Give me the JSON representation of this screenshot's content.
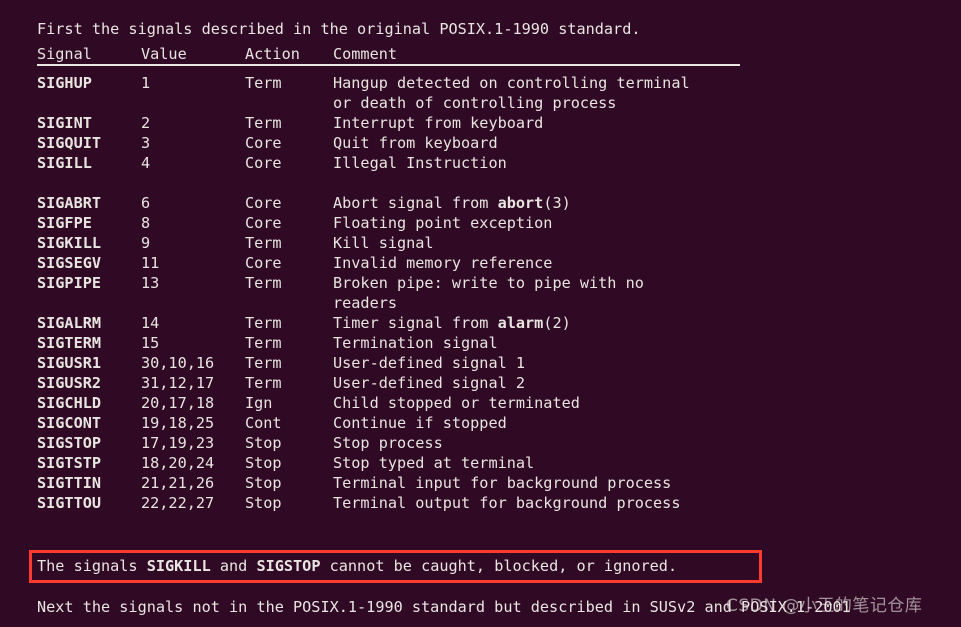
{
  "terminal": {
    "background_color": "#300a24",
    "text_color": "#e9e5e2",
    "highlight_color": "#ff3b30",
    "intro_line": "First the signals described in the original POSIX.1-1990 standard.",
    "columns": {
      "signal": "Signal",
      "value": "Value",
      "action": "Action",
      "comment": "Comment"
    },
    "rows": [
      {
        "signal": "SIGHUP",
        "value": "1",
        "action": "Term",
        "comment_pre": "Hangup detected on controlling terminal",
        "comment_bold": "",
        "comment_post": "",
        "cont": "or death of controlling process"
      },
      {
        "signal": "SIGINT",
        "value": "2",
        "action": "Term",
        "comment_pre": "Interrupt from keyboard",
        "comment_bold": "",
        "comment_post": "",
        "cont": ""
      },
      {
        "signal": "SIGQUIT",
        "value": "3",
        "action": "Core",
        "comment_pre": "Quit from keyboard",
        "comment_bold": "",
        "comment_post": "",
        "cont": ""
      },
      {
        "signal": "SIGILL",
        "value": "4",
        "action": "Core",
        "comment_pre": "Illegal Instruction",
        "comment_bold": "",
        "comment_post": "",
        "cont": ""
      },
      {
        "signal": "",
        "value": "",
        "action": "",
        "comment_pre": "",
        "comment_bold": "",
        "comment_post": "",
        "cont": ""
      },
      {
        "signal": "SIGABRT",
        "value": "6",
        "action": "Core",
        "comment_pre": "Abort signal from ",
        "comment_bold": "abort",
        "comment_post": "(3)",
        "cont": ""
      },
      {
        "signal": "SIGFPE",
        "value": "8",
        "action": "Core",
        "comment_pre": "Floating point exception",
        "comment_bold": "",
        "comment_post": "",
        "cont": ""
      },
      {
        "signal": "SIGKILL",
        "value": "9",
        "action": "Term",
        "comment_pre": "Kill signal",
        "comment_bold": "",
        "comment_post": "",
        "cont": ""
      },
      {
        "signal": "SIGSEGV",
        "value": "11",
        "action": "Core",
        "comment_pre": "Invalid memory reference",
        "comment_bold": "",
        "comment_post": "",
        "cont": ""
      },
      {
        "signal": "SIGPIPE",
        "value": "13",
        "action": "Term",
        "comment_pre": "Broken pipe: write to pipe with no",
        "comment_bold": "",
        "comment_post": "",
        "cont": "readers"
      },
      {
        "signal": "SIGALRM",
        "value": "14",
        "action": "Term",
        "comment_pre": "Timer signal from ",
        "comment_bold": "alarm",
        "comment_post": "(2)",
        "cont": ""
      },
      {
        "signal": "SIGTERM",
        "value": "15",
        "action": "Term",
        "comment_pre": "Termination signal",
        "comment_bold": "",
        "comment_post": "",
        "cont": ""
      },
      {
        "signal": "SIGUSR1",
        "value": "30,10,16",
        "action": "Term",
        "comment_pre": "User-defined signal 1",
        "comment_bold": "",
        "comment_post": "",
        "cont": ""
      },
      {
        "signal": "SIGUSR2",
        "value": "31,12,17",
        "action": "Term",
        "comment_pre": "User-defined signal 2",
        "comment_bold": "",
        "comment_post": "",
        "cont": ""
      },
      {
        "signal": "SIGCHLD",
        "value": "20,17,18",
        "action": "Ign",
        "comment_pre": "Child stopped or terminated",
        "comment_bold": "",
        "comment_post": "",
        "cont": ""
      },
      {
        "signal": "SIGCONT",
        "value": "19,18,25",
        "action": "Cont",
        "comment_pre": "Continue if stopped",
        "comment_bold": "",
        "comment_post": "",
        "cont": ""
      },
      {
        "signal": "SIGSTOP",
        "value": "17,19,23",
        "action": "Stop",
        "comment_pre": "Stop process",
        "comment_bold": "",
        "comment_post": "",
        "cont": ""
      },
      {
        "signal": "SIGTSTP",
        "value": "18,20,24",
        "action": "Stop",
        "comment_pre": "Stop typed at terminal",
        "comment_bold": "",
        "comment_post": "",
        "cont": ""
      },
      {
        "signal": "SIGTTIN",
        "value": "21,21,26",
        "action": "Stop",
        "comment_pre": "Terminal input for background process",
        "comment_bold": "",
        "comment_post": "",
        "cont": ""
      },
      {
        "signal": "SIGTTOU",
        "value": "22,22,27",
        "action": "Stop",
        "comment_pre": "Terminal output for background process",
        "comment_bold": "",
        "comment_post": "",
        "cont": ""
      }
    ],
    "warning": {
      "pre": "The signals ",
      "bold1": "SIGKILL",
      "mid": " and ",
      "bold2": "SIGSTOP",
      "post": " cannot be caught, blocked, or ignored."
    },
    "next_line": "Next the signals not in the POSIX.1-1990 standard but described in SUSv2 and POSIX.1-2001",
    "watermark": "CSDN @小王的笔记仓库"
  }
}
